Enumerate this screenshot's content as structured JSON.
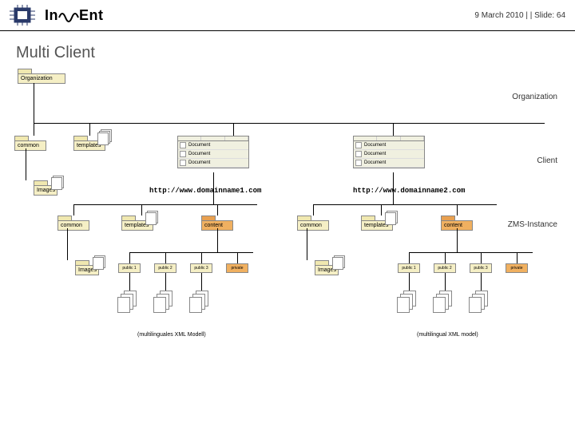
{
  "header": {
    "brand": "InWEnt",
    "meta": "9 March 2010 |  | Slide: 64"
  },
  "title": "Multi Client",
  "labels": {
    "org1": "Organization",
    "org2": "Organization",
    "client": "Client",
    "zms": "ZMS-Instance"
  },
  "folders": {
    "common": "common",
    "templates": "templates",
    "content": "content",
    "images": "Images"
  },
  "docs": {
    "doc": "Document"
  },
  "urls": {
    "u1": "http://www.domainname1.com",
    "u2": "http://www.domainname2.com"
  },
  "boxes": {
    "public1": "public 1",
    "public2": "public 2",
    "public3": "public 3",
    "private": "private"
  },
  "notes": {
    "left": "(multilinguales XML Modell)",
    "right": "(multilingual XML model)"
  }
}
